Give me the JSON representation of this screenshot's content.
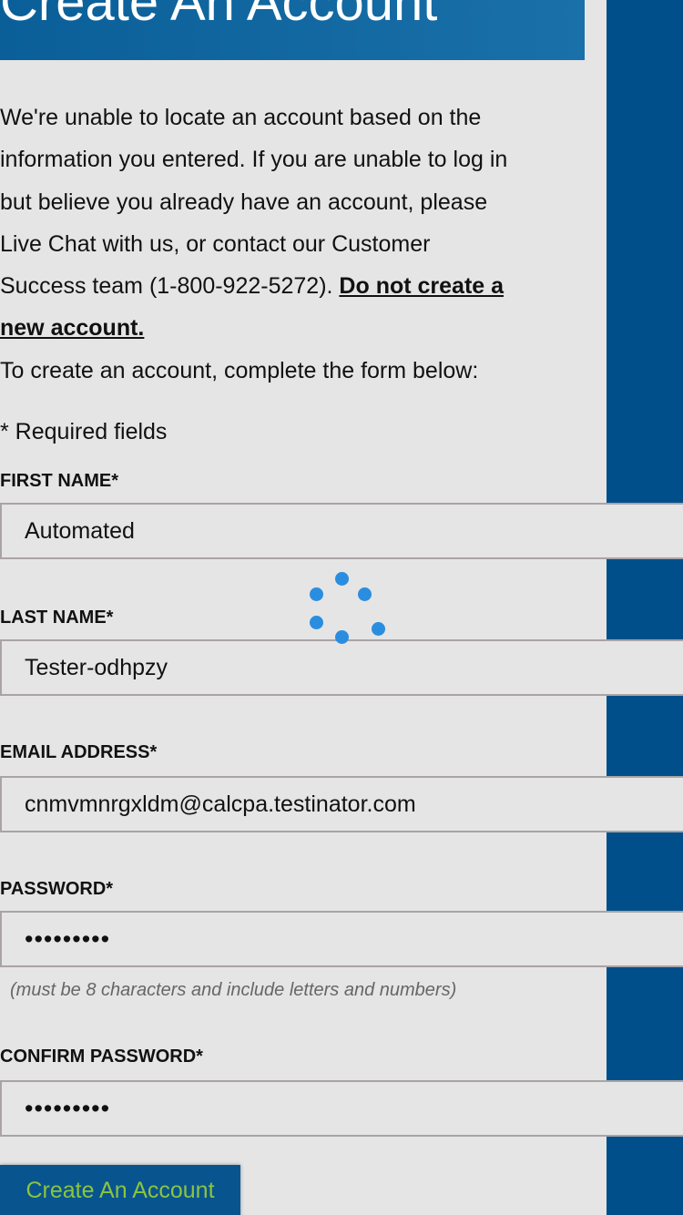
{
  "header": {
    "title": "Create An Account"
  },
  "intro": {
    "message": "We're unable to locate an account based on the information you entered. If you are unable to log in but believe you already have an account, please Live Chat with us, or contact our Customer Success team (1-800-922-5272).",
    "warning": "Do not create a new account.",
    "instruction": "To create an account, complete the form below:"
  },
  "form": {
    "required_note": "* Required fields",
    "first_name": {
      "label": "FIRST NAME*",
      "value": "Automated"
    },
    "last_name": {
      "label": "LAST NAME*",
      "value": "Tester-odhpzy"
    },
    "email": {
      "label": "EMAIL ADDRESS*",
      "value": "cnmvmnrgxldm@calcpa.testinator.com"
    },
    "password": {
      "label": "PASSWORD*",
      "value": "•••••••••"
    },
    "password_hint": "(must be 8 characters and include letters and numbers)",
    "confirm_password": {
      "label": "CONFIRM PASSWORD*",
      "value": "•••••••••"
    },
    "submit_label": "Create An Account"
  },
  "colors": {
    "brand_blue": "#004f8b",
    "header_blue": "#156aa3",
    "button_text_green": "#8bc53f",
    "spinner_blue": "#2b8de0"
  }
}
